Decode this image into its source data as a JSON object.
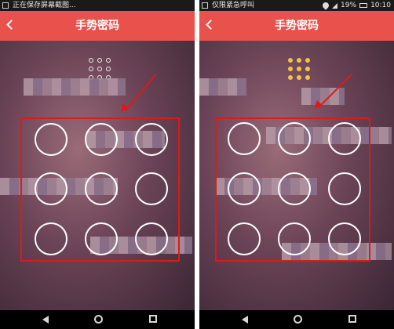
{
  "left": {
    "status_text": "正在保存屏幕截图...",
    "title": "手势密码",
    "grid_filled": false
  },
  "right": {
    "status_text": "仅限紧急呼叫",
    "battery": "19%",
    "time": "10:10",
    "title": "手势密码",
    "grid_filled": true
  },
  "colors": {
    "header": "#e9524c",
    "annotation": "#e01818",
    "grid_dot_active": "#f3c246"
  },
  "icons": [
    "back-icon",
    "grid-icon",
    "wifi-icon",
    "signal-icon",
    "battery-icon",
    "nav-back-icon",
    "nav-home-icon",
    "nav-recent-icon"
  ]
}
